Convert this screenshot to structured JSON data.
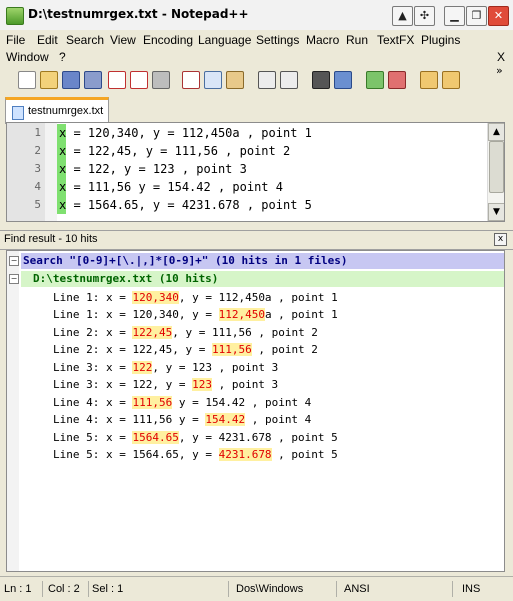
{
  "window": {
    "title": "D:\\testnumrgex.txt - Notepad++",
    "buttons": {
      "minimize": "▁",
      "restore": "❐",
      "close": "✕"
    }
  },
  "menu": {
    "items": [
      "File",
      "Edit",
      "Search",
      "View",
      "Encoding",
      "Language",
      "Settings",
      "Macro",
      "Run",
      "TextFX",
      "Plugins"
    ],
    "row2": [
      "Window",
      "?"
    ],
    "close_mark": "X",
    "chevron": "»"
  },
  "toolbar": {
    "icons": [
      "new-file-icon",
      "open-file-icon",
      "save-icon",
      "save-all-icon",
      "close-icon",
      "close-all-icon",
      "print-icon",
      "cut-icon",
      "copy-icon",
      "paste-icon",
      "undo-icon",
      "redo-icon",
      "find-icon",
      "replace-icon",
      "zoom-in-icon",
      "zoom-out-icon",
      "sync-icon",
      "wrap-icon"
    ]
  },
  "tab": {
    "label": "testnumrgex.txt"
  },
  "editor": {
    "lines": [
      {
        "num": "1",
        "text": "x = 120,340, y = 112,450a , point 1"
      },
      {
        "num": "2",
        "text": "x = 122,45, y = 111,56 , point 2"
      },
      {
        "num": "3",
        "text": "x = 122, y = 123 , point 3"
      },
      {
        "num": "4",
        "text": "x = 111,56 y = 154.42 , point 4"
      },
      {
        "num": "5",
        "text": "x = 1564.65, y = 4231.678 , point 5"
      }
    ]
  },
  "find_panel": {
    "header": "Find result - 10 hits",
    "close_mark": "x",
    "search_line": "Search \"[0-9]+[\\.|,]*[0-9]+\" (10 hits in 1 files)",
    "file_line": "D:\\testnumrgex.txt (10 hits)",
    "results": [
      {
        "pre": "Line 1: x = ",
        "match": "120,340",
        "post": ", y = 112,450a , point 1"
      },
      {
        "pre": "Line 1: x = 120,340, y = ",
        "match": "112,450",
        "post": "a , point 1"
      },
      {
        "pre": "Line 2: x = ",
        "match": "122,45",
        "post": ", y = 111,56 , point 2"
      },
      {
        "pre": "Line 2: x = 122,45, y = ",
        "match": "111,56",
        "post": " , point 2"
      },
      {
        "pre": "Line 3: x = ",
        "match": "122",
        "post": ", y = 123 , point 3"
      },
      {
        "pre": "Line 3: x = 122, y = ",
        "match": "123",
        "post": " , point 3"
      },
      {
        "pre": "Line 4: x = ",
        "match": "111,56",
        "post": " y = 154.42 , point 4"
      },
      {
        "pre": "Line 4: x = 111,56 y = ",
        "match": "154.42",
        "post": " , point 4"
      },
      {
        "pre": "Line 5: x = ",
        "match": "1564.65",
        "post": ", y = 4231.678 , point 5"
      },
      {
        "pre": "Line 5: x = 1564.65, y = ",
        "match": "4231.678",
        "post": " , point 5"
      }
    ]
  },
  "status": {
    "ln": "Ln : 1",
    "col": "Col : 2",
    "sel": "Sel : 1",
    "eol": "Dos\\Windows",
    "encoding": "ANSI",
    "mode": "INS"
  },
  "colors": {
    "match_highlight": "#fff0a0",
    "match_text": "#e00000",
    "search_bg": "#c7c7f2",
    "file_bg": "#d6f5c8"
  }
}
